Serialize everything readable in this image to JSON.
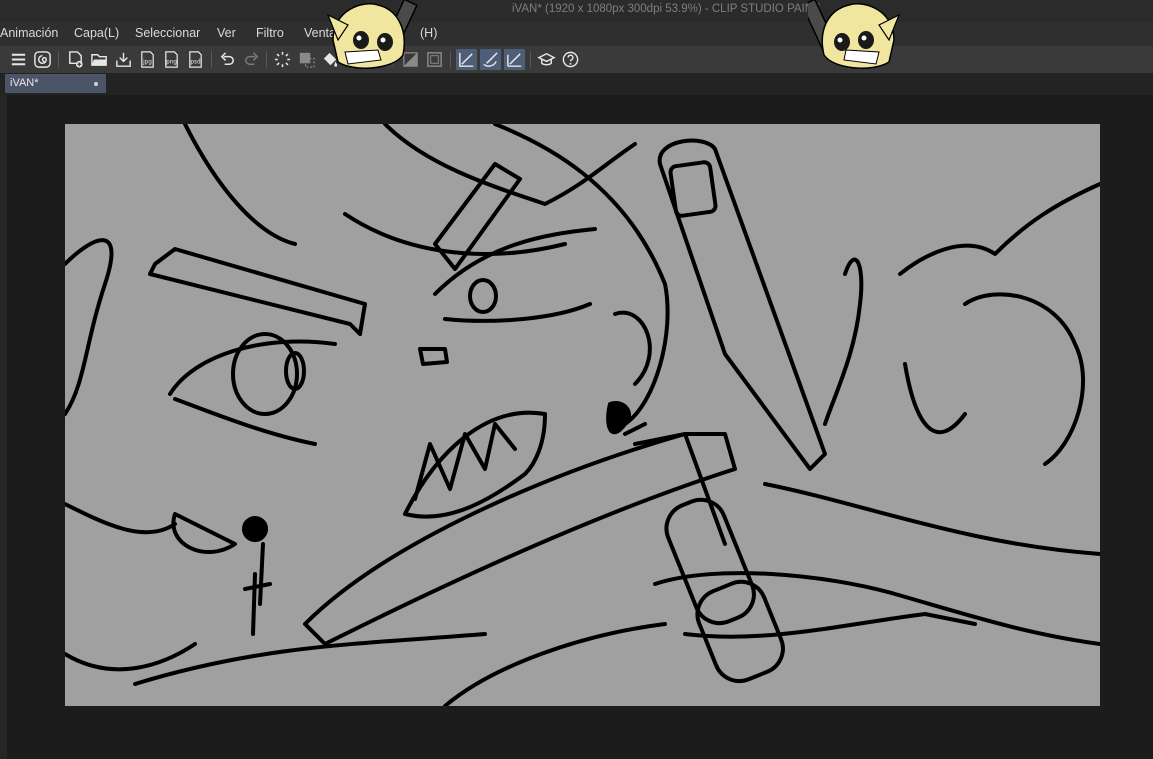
{
  "window": {
    "title": "iVAN* (1920 x 1080px 300dpi 53.9%)  - CLIP STUDIO PAINT"
  },
  "menu": {
    "items": [
      {
        "key": "animacion",
        "label": "Animación"
      },
      {
        "key": "capa",
        "label": "Capa(L)"
      },
      {
        "key": "seleccionar",
        "label": "Seleccionar"
      },
      {
        "key": "ver",
        "label": "Ver"
      },
      {
        "key": "filtro",
        "label": "Filtro"
      },
      {
        "key": "ventana",
        "label": "Venta"
      },
      {
        "key": "ayuda",
        "label": "(H)"
      }
    ]
  },
  "toolbar": {
    "buttons": [
      {
        "name": "menu-icon"
      },
      {
        "name": "clip-studio-icon"
      },
      {
        "name": "new-canvas-icon"
      },
      {
        "name": "open-folder-icon"
      },
      {
        "name": "save-icon"
      },
      {
        "name": "export-jpg-icon",
        "text": "jpg"
      },
      {
        "name": "export-png-icon",
        "text": "png"
      },
      {
        "name": "export-psd-icon",
        "text": "psd"
      },
      {
        "name": "undo-icon"
      },
      {
        "name": "redo-icon"
      },
      {
        "name": "loading-icon"
      },
      {
        "name": "transform-icon"
      },
      {
        "name": "fill-icon"
      },
      {
        "name": "crop-icon"
      },
      {
        "name": "ruler-snap-icon"
      },
      {
        "name": "tone-icon"
      },
      {
        "name": "frame-icon"
      },
      {
        "name": "snap-to-ruler-icon",
        "active": true
      },
      {
        "name": "snap-to-special-ruler-icon",
        "active": true
      },
      {
        "name": "snap-to-grid-icon",
        "active": true
      },
      {
        "name": "learning-icon"
      },
      {
        "name": "help-icon"
      }
    ]
  },
  "document_tab": {
    "label": "iVAN*"
  },
  "colors": {
    "canvas": "#a0a0a0",
    "workspace": "#1c1c1c",
    "active_button": "#4d5f78",
    "tab": "#4c5567",
    "mascot_hair": "#f1e6a0"
  }
}
